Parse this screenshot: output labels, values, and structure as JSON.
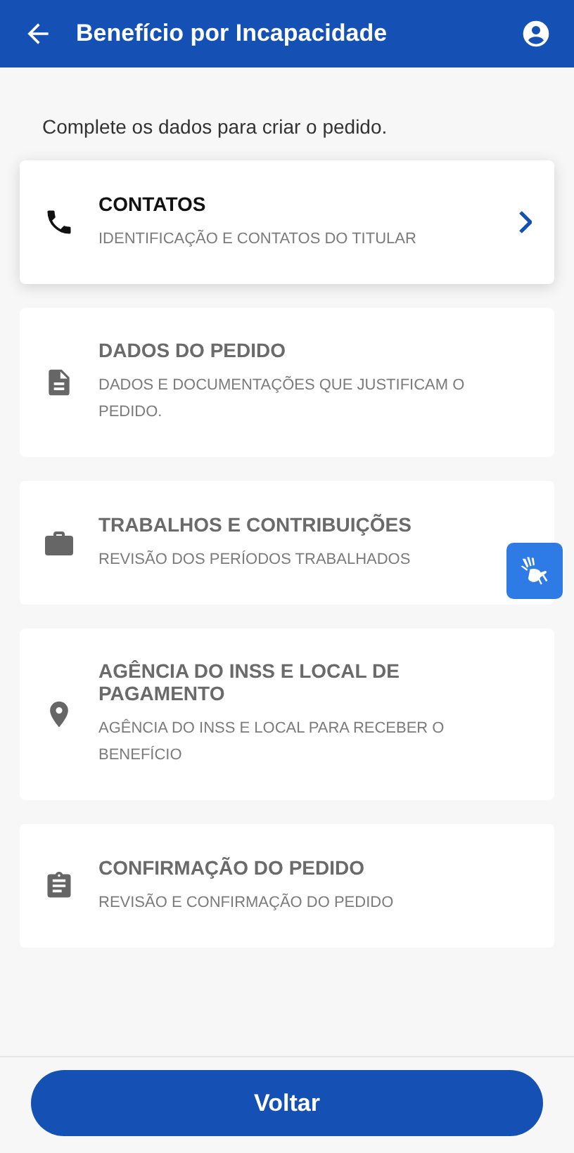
{
  "header": {
    "title": "Benefício por Incapacidade"
  },
  "intro": "Complete os dados para criar o pedido.",
  "steps": [
    {
      "kind": "phone",
      "title": "CONTATOS",
      "subtitle": "IDENTIFICAÇÃO E CONTATOS DO TITULAR",
      "selected": true
    },
    {
      "kind": "document",
      "title": "DADOS DO PEDIDO",
      "subtitle": "DADOS E DOCUMENTAÇÕES QUE JUSTIFICAM O PEDIDO.",
      "selected": false
    },
    {
      "kind": "briefcase",
      "title": "TRABALHOS E CONTRIBUIÇÕES",
      "subtitle": "REVISÃO DOS PERÍODOS TRABALHADOS",
      "selected": false
    },
    {
      "kind": "pin",
      "title": "AGÊNCIA DO INSS E LOCAL DE PAGAMENTO",
      "subtitle": "AGÊNCIA DO INSS E LOCAL PARA RECEBER O BENEFÍCIO",
      "selected": false
    },
    {
      "kind": "clipboard",
      "title": "CONFIRMAÇÃO DO PEDIDO",
      "subtitle": "REVISÃO E CONFIRMAÇÃO DO PEDIDO",
      "selected": false
    }
  ],
  "footer": {
    "button": "Voltar"
  }
}
